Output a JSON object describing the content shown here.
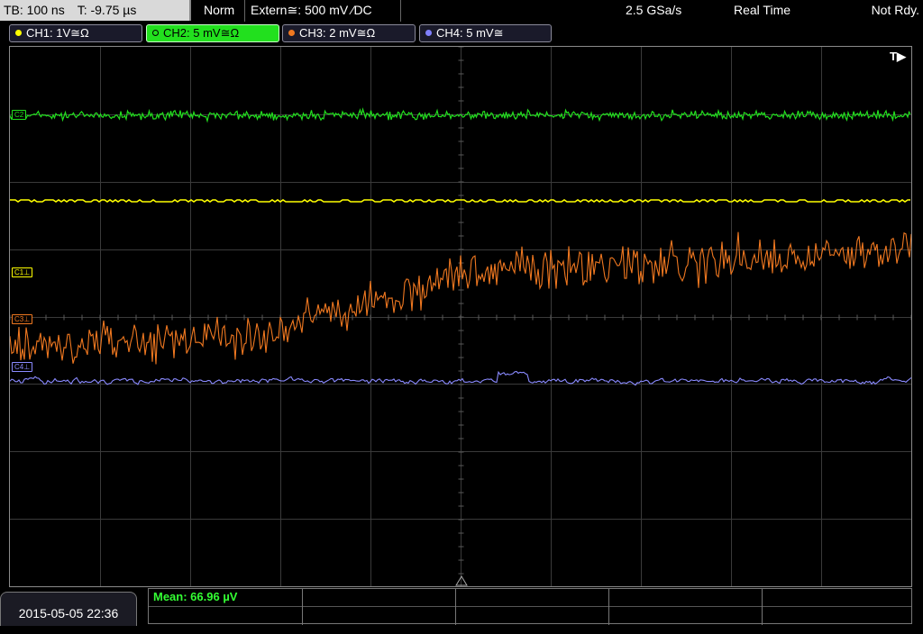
{
  "status_bar": {
    "timebase": "TB: 100 ns",
    "trigger_time": "T: -9.75 µs",
    "trigger_mode": "Norm",
    "trigger_source": "Extern≅: 500 mV ⁄DC",
    "sample_rate": "2.5 GSa/s",
    "acquisition_mode": "Real Time",
    "run_state": "Not Rdy."
  },
  "channels": [
    {
      "label": "CH1: 1V≅Ω",
      "color": "#ffff00"
    },
    {
      "label": "CH2: 5 mV≅Ω",
      "color": "#22e01e"
    },
    {
      "label": "CH3: 2 mV≅Ω",
      "color": "#f07820"
    },
    {
      "label": "CH4: 5 mV≅",
      "color": "#8080ff"
    }
  ],
  "markers": {
    "c2": "C2",
    "c1": "C1⊥",
    "c3": "C3⊥",
    "c4": "C4⊥"
  },
  "trigger_indicator": "T▶",
  "footer": {
    "datetime": "2015-05-05 22:36",
    "measurement": "Mean: 66.96 µV"
  }
}
